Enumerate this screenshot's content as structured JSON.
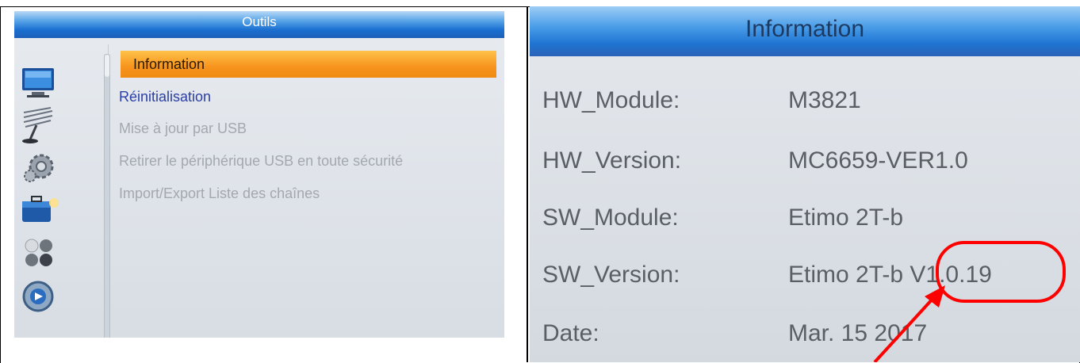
{
  "left_panel": {
    "title": "Outils",
    "menu": [
      {
        "label": "Information",
        "state": "selected"
      },
      {
        "label": "Réinitialisation",
        "state": "active"
      },
      {
        "label": "Mise à jour par USB",
        "state": "disabled"
      },
      {
        "label": "Retirer le périphérique USB en toute sécurité",
        "state": "disabled"
      },
      {
        "label": "Import/Export Liste des chaînes",
        "state": "disabled"
      }
    ],
    "side_icons": [
      "tv-icon",
      "satellite-dish-icon",
      "settings-gear-icon",
      "toolbox-icon",
      "games-icon",
      "media-disc-icon"
    ]
  },
  "right_panel": {
    "title": "Information",
    "rows": [
      {
        "label": "HW_Module:",
        "value": "M3821"
      },
      {
        "label": "HW_Version:",
        "value": "MC6659-VER1.0"
      },
      {
        "label": "SW_Module:",
        "value": "Etimo 2T-b"
      },
      {
        "label": "SW_Version:",
        "value": "Etimo 2T-b",
        "highlight": "V1.0.19"
      },
      {
        "label": "Date:",
        "value": "Mar. 15 2017"
      }
    ]
  },
  "colors": {
    "title_bar": "#1a6fd0",
    "selection": "#f7941d",
    "annotation": "#ff0000"
  }
}
